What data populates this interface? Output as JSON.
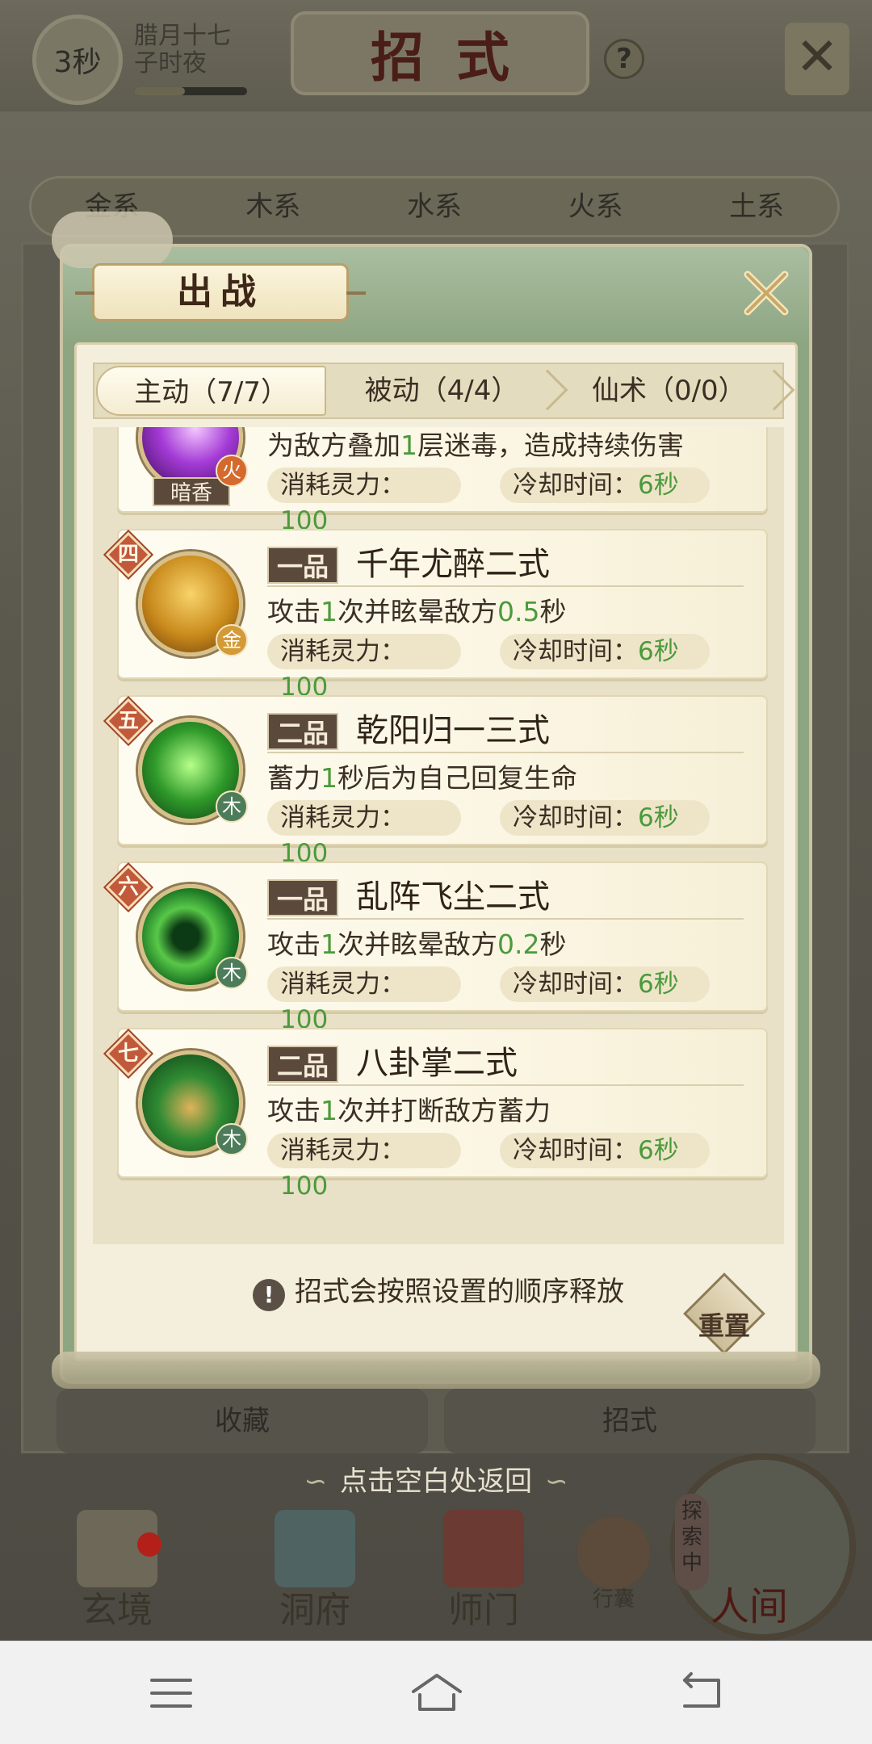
{
  "header": {
    "timer": "3秒",
    "lunar_date": "腊月十七",
    "lunar_time": "子时夜",
    "title": "招式",
    "help": "?"
  },
  "element_tabs": [
    "金系",
    "木系",
    "水系",
    "火系",
    "土系"
  ],
  "background_tabs": [
    "收藏",
    "招式"
  ],
  "modal": {
    "title": "出战",
    "tabs": [
      {
        "label": "主动（7/7）",
        "active": true
      },
      {
        "label": "被动（4/4）",
        "active": false
      },
      {
        "label": "仙术（0/0）",
        "active": false
      }
    ],
    "partial_card": {
      "icon": "purple-burst-icon",
      "icon_label": "暗香",
      "element": "火",
      "desc": "为敌方叠加1层迷毒，造成持续伤害",
      "desc_parts": [
        "为敌方叠加",
        "1",
        "层迷毒，造成持续伤害"
      ],
      "cost_label": "消耗灵力：",
      "cost": "100",
      "cd_label": "冷却时间：",
      "cd": "6秒"
    },
    "cards": [
      {
        "rank": "四",
        "grade": "一品",
        "name": "千年尤醉二式",
        "element": "金",
        "element_key": "gold",
        "icon": "golden-buddha-icon",
        "desc_parts": [
          "攻击",
          "1",
          "次并眩晕敌方",
          "0.5",
          "秒"
        ],
        "cost_label": "消耗灵力：",
        "cost": "100",
        "cd_label": "冷却时间：",
        "cd": "6秒"
      },
      {
        "rank": "五",
        "grade": "二品",
        "name": "乾阳归一三式",
        "element": "木",
        "element_key": "wood",
        "icon": "green-figure-icon",
        "desc_parts": [
          "蓄力",
          "1",
          "秒后为自己回复生命"
        ],
        "cost_label": "消耗灵力：",
        "cost": "100",
        "cd_label": "冷却时间：",
        "cd": "6秒"
      },
      {
        "rank": "六",
        "grade": "一品",
        "name": "乱阵飞尘二式",
        "element": "木",
        "element_key": "wood",
        "icon": "green-vortex-icon",
        "desc_parts": [
          "攻击",
          "1",
          "次并眩晕敌方",
          "0.2",
          "秒"
        ],
        "cost_label": "消耗灵力：",
        "cost": "100",
        "cd_label": "冷却时间：",
        "cd": "6秒"
      },
      {
        "rank": "七",
        "grade": "二品",
        "name": "八卦掌二式",
        "element": "木",
        "element_key": "wood",
        "icon": "palm-strike-icon",
        "desc_parts": [
          "攻击",
          "1",
          "次并打断敌方蓄力"
        ],
        "cost_label": "消耗灵力：",
        "cost": "100",
        "cd_label": "冷却时间：",
        "cd": "6秒"
      }
    ],
    "notice": "招式会按照设置的顺序释放",
    "reset": "重置"
  },
  "return_hint": "点击空白处返回",
  "bottom_nav": [
    {
      "label": "玄境",
      "icon": "scroll-icon",
      "badge": true
    },
    {
      "label": "洞府",
      "icon": "pavilion-icon",
      "badge": false
    },
    {
      "label": "师门",
      "icon": "banner-icon",
      "badge": false
    },
    {
      "label": "行囊",
      "icon": "bag-icon",
      "badge": false
    }
  ],
  "explore": {
    "tag": "探索中",
    "label": "人间"
  },
  "colors": {
    "accent_green": "#4b9a3c",
    "rank_red": "#c1593a",
    "frame_green": "#8ea582",
    "parchment": "#f4efdc"
  }
}
